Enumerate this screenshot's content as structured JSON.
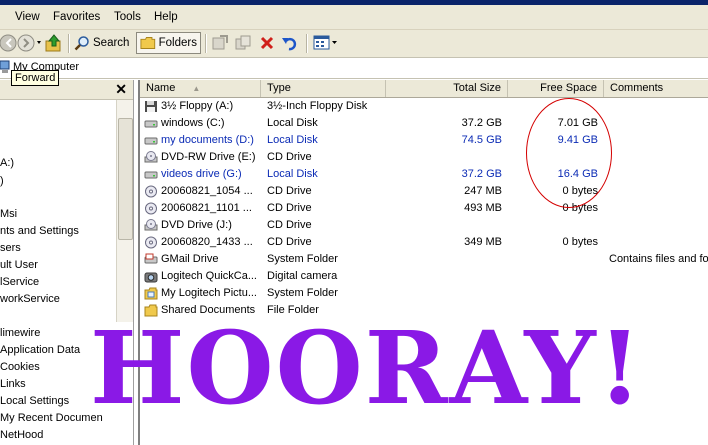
{
  "menu": {
    "items": [
      "View",
      "Favorites",
      "Tools",
      "Help"
    ]
  },
  "toolbar": {
    "search_label": "Search",
    "folders_label": "Folders"
  },
  "address": {
    "value": "My Computer"
  },
  "tooltip": {
    "text": "Forward"
  },
  "left_pane": {
    "close": "✕",
    "items": [
      "A:)",
      ")",
      "Msi",
      "nts and Settings",
      "sers",
      "ult User",
      "lService",
      "workService",
      "limewire",
      "Application Data",
      "Cookies",
      "Links",
      "Local Settings",
      "My Recent Documen",
      "NetHood"
    ]
  },
  "columns": [
    "Name",
    "Type",
    "Total Size",
    "Free Space",
    "Comments"
  ],
  "sort_indicator": "▲",
  "rows": [
    {
      "name": "3½ Floppy (A:)",
      "type": "3½-Inch Floppy Disk",
      "total": "",
      "free": "",
      "comments": "",
      "icon": "floppy-icon",
      "blue": false
    },
    {
      "name": "windows (C:)",
      "type": "Local Disk",
      "total": "37.2 GB",
      "free": "7.01 GB",
      "comments": "",
      "icon": "hard-drive-icon",
      "blue": false
    },
    {
      "name": "my documents (D:)",
      "type": "Local Disk",
      "total": "74.5 GB",
      "free": "9.41 GB",
      "comments": "",
      "icon": "hard-drive-icon",
      "blue": true
    },
    {
      "name": "DVD-RW Drive (E:)",
      "type": "CD Drive",
      "total": "",
      "free": "",
      "comments": "",
      "icon": "dvd-drive-icon",
      "blue": false
    },
    {
      "name": "videos drive (G:)",
      "type": "Local Disk",
      "total": "37.2 GB",
      "free": "16.4 GB",
      "comments": "",
      "icon": "hard-drive-icon",
      "blue": true
    },
    {
      "name": "20060821_1054 ...",
      "type": "CD Drive",
      "total": "247 MB",
      "free": "0 bytes",
      "comments": "",
      "icon": "cd-icon",
      "blue": false
    },
    {
      "name": "20060821_1101 ...",
      "type": "CD Drive",
      "total": "493 MB",
      "free": "0 bytes",
      "comments": "",
      "icon": "cd-icon",
      "blue": false
    },
    {
      "name": "DVD Drive (J:)",
      "type": "CD Drive",
      "total": "",
      "free": "",
      "comments": "",
      "icon": "dvd-drive-icon",
      "blue": false
    },
    {
      "name": "20060820_1433 ...",
      "type": "CD Drive",
      "total": "349 MB",
      "free": "0 bytes",
      "comments": "",
      "icon": "cd-icon",
      "blue": false
    },
    {
      "name": "GMail Drive",
      "type": "System Folder",
      "total": "",
      "free": "",
      "comments": "Contains files and fol",
      "icon": "gmail-drive-icon",
      "blue": false
    },
    {
      "name": "Logitech QuickCa...",
      "type": "Digital camera",
      "total": "",
      "free": "",
      "comments": "",
      "icon": "camera-icon",
      "blue": false
    },
    {
      "name": "My Logitech Pictu...",
      "type": "System Folder",
      "total": "",
      "free": "",
      "comments": "",
      "icon": "pictures-folder-icon",
      "blue": false
    },
    {
      "name": "Shared Documents",
      "type": "File Folder",
      "total": "",
      "free": "",
      "comments": "",
      "icon": "folder-icon",
      "blue": false
    }
  ],
  "overlay": {
    "text": "HOORAY!",
    "color": "#8a19e6",
    "circle_color": "#d40000"
  }
}
